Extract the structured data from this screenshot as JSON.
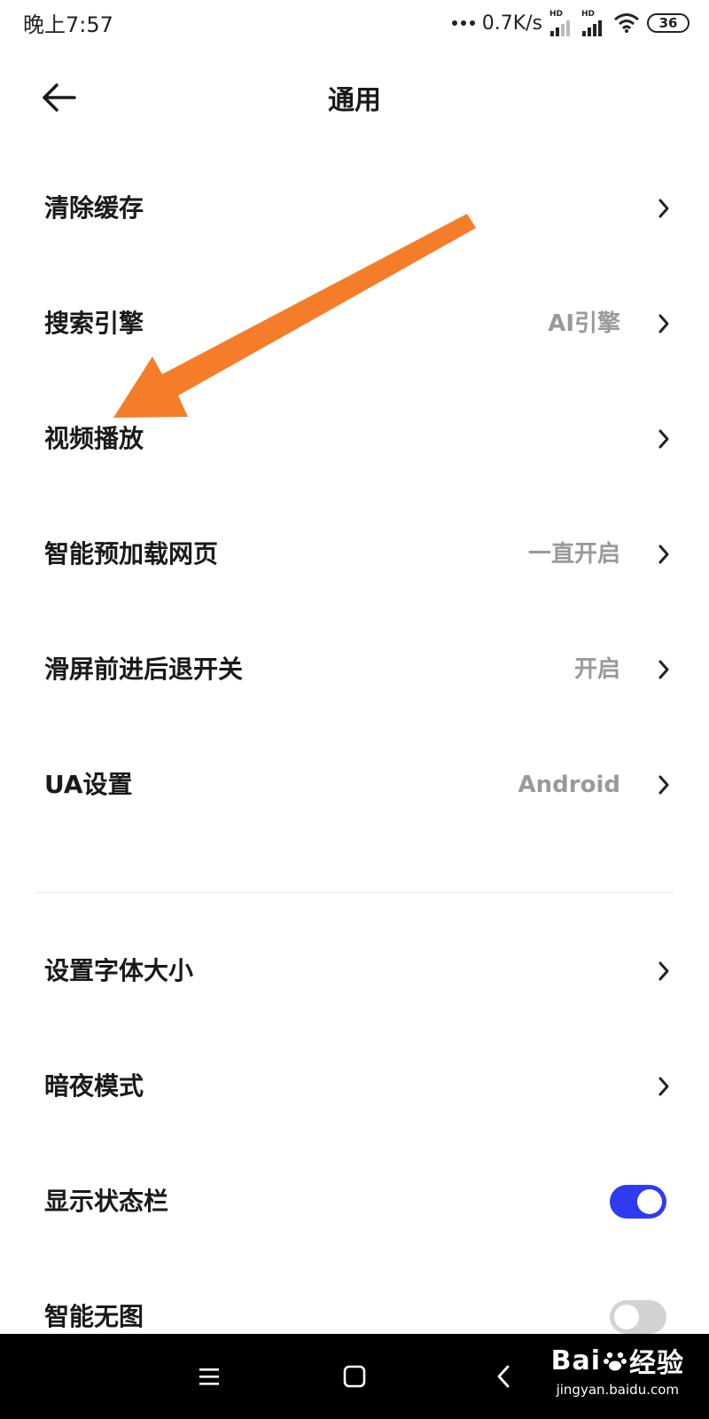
{
  "status_bar": {
    "time": "晚上7:57",
    "net_speed": "0.7K/s",
    "sim1_label": "HD",
    "sim2_label": "HD",
    "battery": "36"
  },
  "header": {
    "title": "通用",
    "back_icon": "arrow-left-icon"
  },
  "settings": [
    {
      "label": "清除缓存",
      "value": "",
      "control": "chevron"
    },
    {
      "label": "搜索引擎",
      "value": "AI引擎",
      "control": "chevron"
    },
    {
      "label": "视频播放",
      "value": "",
      "control": "chevron"
    },
    {
      "label": "智能预加载网页",
      "value": "一直开启",
      "control": "chevron"
    },
    {
      "label": "滑屏前进后退开关",
      "value": "开启",
      "control": "chevron"
    },
    {
      "label": "UA设置",
      "value": "Android",
      "control": "chevron"
    },
    {
      "label": "设置字体大小",
      "value": "",
      "control": "chevron"
    },
    {
      "label": "暗夜模式",
      "value": "",
      "control": "chevron"
    },
    {
      "label": "显示状态栏",
      "value": "",
      "control": "toggle",
      "toggle_on": true
    },
    {
      "label": "智能无图",
      "value": "",
      "control": "toggle",
      "toggle_on": false
    }
  ],
  "colors": {
    "accent": "#2f3bf0",
    "annotation_arrow": "#f57c28",
    "value_text": "#9a9a9a"
  },
  "nav_bar": {
    "menu_icon": "menu-icon",
    "home_icon": "square-home-icon",
    "back_icon": "chevron-left-icon"
  },
  "watermark": {
    "logo_text": "Bai",
    "logo_text_cn": "经验",
    "url": "jingyan.baidu.com"
  }
}
